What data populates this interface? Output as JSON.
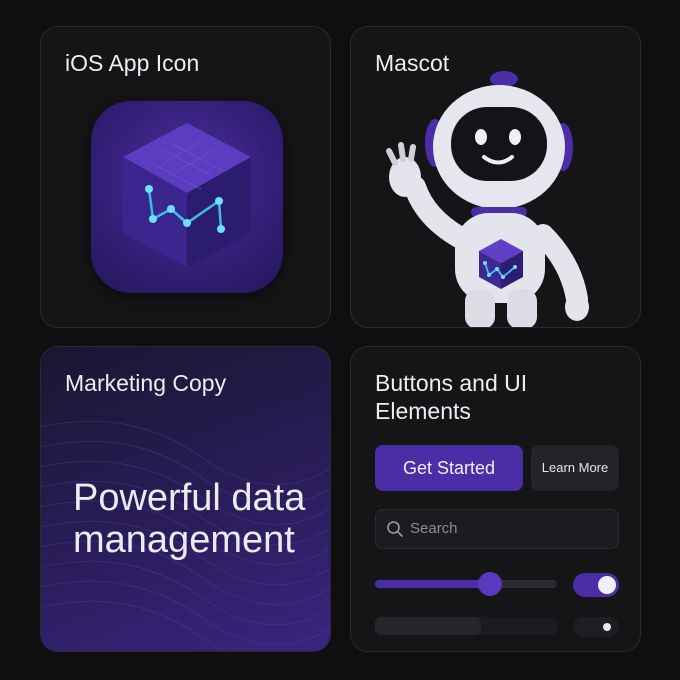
{
  "cards": {
    "app_icon": {
      "title": "iOS App Icon"
    },
    "mascot": {
      "title": "Mascot"
    },
    "marketing": {
      "title": "Marketing Copy",
      "headline": "Powerful data management"
    },
    "buttons": {
      "title": "Buttons and UI Elements",
      "primary_label": "Get Started",
      "secondary_label": "Learn More",
      "search_placeholder": "Search",
      "slider_value": 0.63,
      "toggle_on": true,
      "progress_value": 0.58,
      "toggle_off": false
    }
  },
  "colors": {
    "background": "#0f0f11",
    "card": "#151518",
    "accent": "#4b2ea6",
    "text": "#ecebf0",
    "glow": "#39c6f0"
  },
  "icons": [
    "cube-logo-icon",
    "robot-mascot-icon",
    "search-icon"
  ]
}
